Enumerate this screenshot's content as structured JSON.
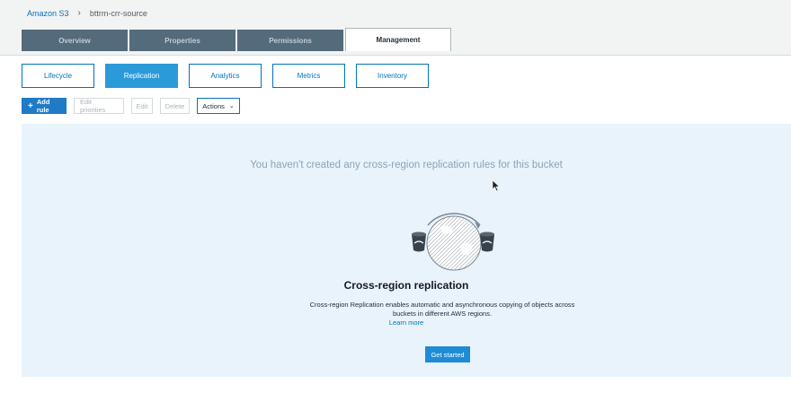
{
  "breadcrumb": {
    "root": "Amazon S3",
    "separator": "›",
    "bucket": "bttrm-crr-source"
  },
  "tabs": [
    {
      "label": "Overview"
    },
    {
      "label": "Properties"
    },
    {
      "label": "Permissions"
    },
    {
      "label": "Management",
      "active": true
    }
  ],
  "subtabs": [
    {
      "label": "Lifecycle"
    },
    {
      "label": "Replication",
      "active": true
    },
    {
      "label": "Analytics"
    },
    {
      "label": "Metrics"
    },
    {
      "label": "Inventory"
    }
  ],
  "toolbar": {
    "add_rule": "Add rule",
    "edit_priorities": "Edit priorities",
    "edit": "Edit",
    "delete": "Delete",
    "actions": "Actions"
  },
  "empty_state": {
    "message": "You haven't created any cross-region replication rules for this bucket",
    "feature_title": "Cross-region replication",
    "feature_desc": "Cross-region Replication enables automatic and asynchronous copying of objects across buckets in different AWS regions.",
    "learn_more": "Learn more",
    "get_started": "Get started"
  },
  "colors": {
    "primary": "#1f7bc6",
    "panel_bg": "#e9f3fb",
    "tab_inactive": "#546b7b"
  },
  "icons": [
    "plus-icon",
    "chevron-down-icon",
    "globe-replication-illustration",
    "mouse-cursor-icon"
  ]
}
